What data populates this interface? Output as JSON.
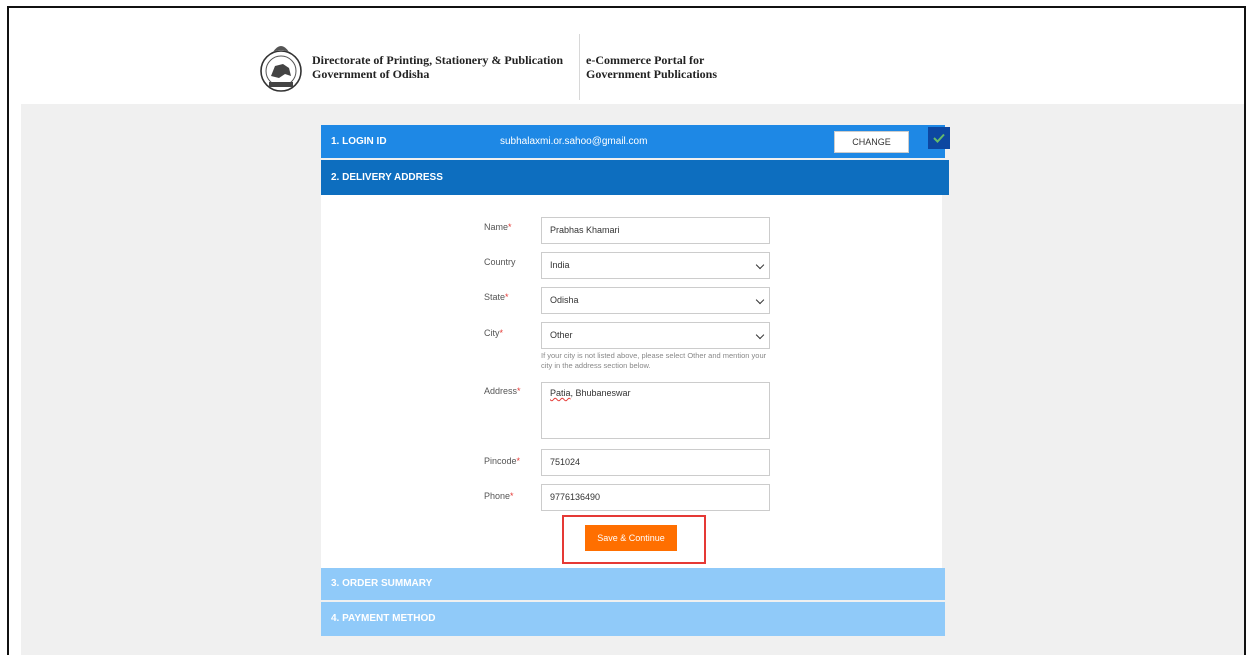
{
  "header": {
    "org_line1": "Directorate of Printing, Stationery & Publication",
    "org_line2": "Government of Odisha",
    "portal_line1": "e-Commerce Portal for",
    "portal_line2": "Government Publications"
  },
  "steps": {
    "login": {
      "label": "1. LOGIN ID",
      "email": "subhalaxmi.or.sahoo@gmail.com",
      "change_label": "CHANGE"
    },
    "delivery": {
      "label": "2. DELIVERY ADDRESS"
    },
    "order_summary": {
      "label": "3. ORDER SUMMARY"
    },
    "payment": {
      "label": "4. PAYMENT METHOD"
    }
  },
  "form": {
    "name": {
      "label": "Name",
      "value": "Prabhas Khamari"
    },
    "country": {
      "label": "Country",
      "value": "India"
    },
    "state": {
      "label": "State",
      "value": "Odisha"
    },
    "city": {
      "label": "City",
      "value": "Other",
      "hint": "If your city is not listed above, please select Other and mention your city in the address section below."
    },
    "address": {
      "label": "Address",
      "value_word1": "Patia",
      "value_rest": ", Bhubaneswar"
    },
    "pincode": {
      "label": "Pincode",
      "value": "751024"
    },
    "phone": {
      "label": "Phone",
      "value": "9776136490"
    },
    "required_mark": "*",
    "save_label": "Save & Continue"
  },
  "colors": {
    "step_active": "#1e88e5",
    "step_current": "#0d6ebf",
    "step_inactive": "#90caf9",
    "save_button": "#ff6f00",
    "highlight": "#e53935"
  },
  "icons": {
    "emblem": "odisha-emblem-icon",
    "check": "check-icon",
    "chevron": "chevron-down-icon"
  }
}
